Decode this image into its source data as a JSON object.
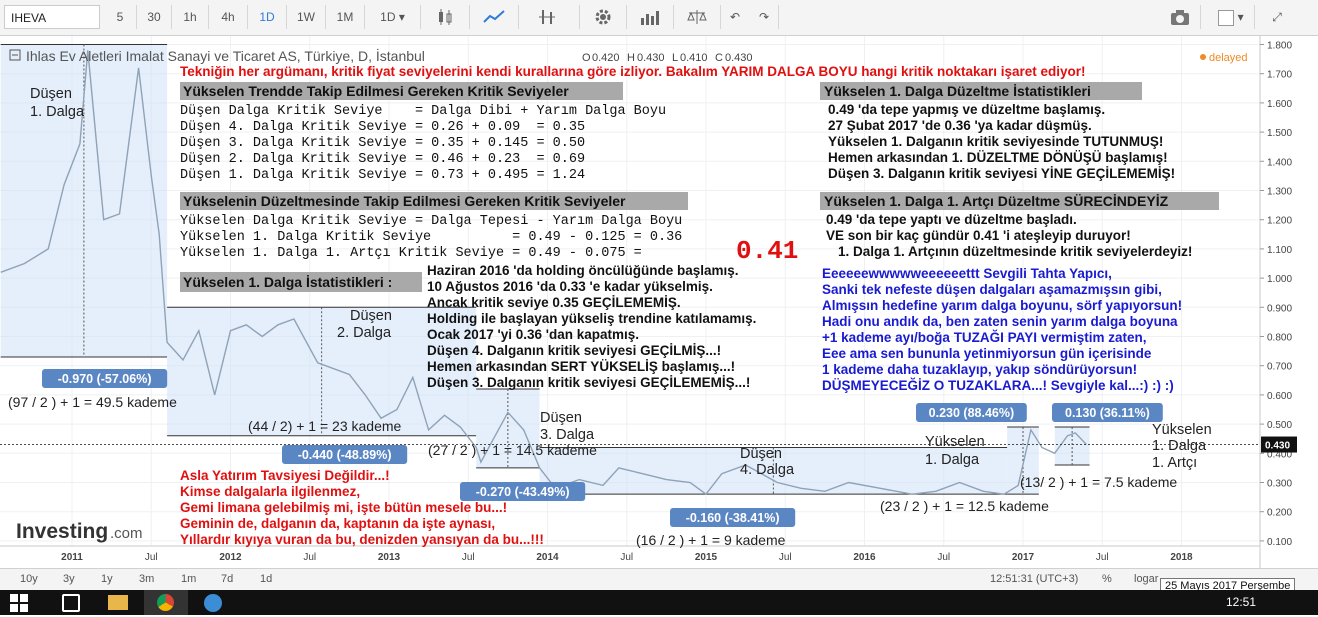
{
  "toolbar": {
    "symbol": "IHEVA",
    "intervals": [
      "5",
      "30",
      "1h",
      "4h",
      "1D",
      "1W",
      "1M"
    ],
    "active_interval": "1D",
    "interval_select": "1D"
  },
  "legend": {
    "title": "Ihlas Ev Aletleri Imalat Sanayi ve Ticaret AS, Türkiye, D, İstanbul",
    "o_label": "O",
    "o_value": "0.420",
    "h_label": "H",
    "h_value": "0.430",
    "l_label": "L",
    "l_value": "0.410",
    "c_label": "C",
    "c_value": "0.430",
    "status": "delayed"
  },
  "bottom": {
    "ranges": [
      "10y",
      "3y",
      "1y",
      "3m",
      "1m",
      "7d",
      "1d"
    ],
    "clock": "12:51:31 (UTC+3)",
    "percent": "%",
    "log": "logar",
    "auto": "auto",
    "tooltip_date": "25 Mayıs 2017 Perşembe"
  },
  "taskbar": {
    "time": "12:51"
  },
  "colors": {
    "price": "#8fa2b6",
    "box_fill": "#cfe2f7",
    "badge": "#5b86c4",
    "red": "#e01010",
    "blue": "#1a1ad0"
  },
  "chart_data": {
    "type": "line",
    "title": "Ihlas Ev Aletleri Imalat Sanayi ve Ticaret AS, Türkiye, D, İstanbul",
    "x_ticks": [
      "2011",
      "Jul",
      "2012",
      "Jul",
      "2013",
      "Jul",
      "2014",
      "Jul",
      "2015",
      "Jul",
      "2016",
      "Jul",
      "2017",
      "Jul",
      "2018"
    ],
    "y_ticks": [
      "1.800",
      "1.700",
      "1.600",
      "1.500",
      "1.400",
      "1.300",
      "1.200",
      "1.100",
      "1.000",
      "0.900",
      "0.800",
      "0.700",
      "0.600",
      "0.500",
      "0.400",
      "0.300",
      "0.200",
      "0.100"
    ],
    "ylim": [
      0.1,
      1.8
    ],
    "last_price": "0.430",
    "series": [
      {
        "values": [
          [
            2010.55,
            1.02
          ],
          [
            2010.7,
            1.05
          ],
          [
            2010.85,
            1.1
          ],
          [
            2010.95,
            1.32
          ],
          [
            2011.05,
            1.46
          ],
          [
            2011.1,
            1.78
          ],
          [
            2011.2,
            1.2
          ],
          [
            2011.3,
            1.22
          ],
          [
            2011.42,
            1.72
          ],
          [
            2011.5,
            1.35
          ],
          [
            2011.55,
            1.15
          ],
          [
            2011.6,
            0.78
          ],
          [
            2011.7,
            0.72
          ],
          [
            2011.8,
            0.82
          ],
          [
            2011.9,
            0.6
          ],
          [
            2012.0,
            0.82
          ],
          [
            2012.1,
            0.84
          ],
          [
            2012.2,
            0.8
          ],
          [
            2012.3,
            0.84
          ],
          [
            2012.4,
            0.86
          ],
          [
            2012.55,
            0.71
          ],
          [
            2012.75,
            0.67
          ],
          [
            2012.85,
            0.6
          ],
          [
            2012.95,
            0.52
          ],
          [
            2013.05,
            0.55
          ],
          [
            2013.15,
            0.66
          ],
          [
            2013.25,
            0.48
          ],
          [
            2013.35,
            0.53
          ],
          [
            2013.45,
            0.49
          ],
          [
            2013.55,
            0.42
          ],
          [
            2013.58,
            0.37
          ],
          [
            2013.65,
            0.44
          ],
          [
            2013.75,
            0.54
          ],
          [
            2013.85,
            0.48
          ],
          [
            2013.95,
            0.35
          ],
          [
            2014.05,
            0.28
          ],
          [
            2014.2,
            0.31
          ],
          [
            2014.35,
            0.29
          ],
          [
            2014.45,
            0.35
          ],
          [
            2014.6,
            0.33
          ],
          [
            2014.75,
            0.31
          ],
          [
            2014.9,
            0.3
          ],
          [
            2015.0,
            0.26
          ],
          [
            2015.1,
            0.33
          ],
          [
            2015.25,
            0.36
          ],
          [
            2015.45,
            0.3
          ],
          [
            2015.6,
            0.28
          ],
          [
            2015.75,
            0.27
          ],
          [
            2015.9,
            0.3
          ],
          [
            2016.1,
            0.28
          ],
          [
            2016.3,
            0.26
          ],
          [
            2016.45,
            0.27
          ],
          [
            2016.6,
            0.3
          ],
          [
            2016.75,
            0.27
          ],
          [
            2016.88,
            0.26
          ],
          [
            2016.97,
            0.29
          ],
          [
            2017.05,
            0.48
          ],
          [
            2017.12,
            0.42
          ],
          [
            2017.2,
            0.4
          ],
          [
            2017.28,
            0.46
          ],
          [
            2017.33,
            0.47
          ],
          [
            2017.4,
            0.43
          ]
        ]
      }
    ],
    "annotations": {
      "measure_badges": [
        "-0.970 (-57.06%)",
        "-0.440 (-48.89%)",
        "-0.270 (-43.49%)",
        "-0.160 (-38.41%)",
        "0.230 (88.46%)",
        "0.130 (36.11%)"
      ],
      "wave_labels": [
        "Düşen",
        "1. Dalga",
        "Düşen",
        "2. Dalga",
        "Düşen",
        "3. Dalga",
        "Düşen",
        "4. Dalga",
        "Yükselen",
        "1. Dalga",
        "Yükselen",
        "1. Dalga",
        "1. Artçı"
      ],
      "kademe": [
        "(97 / 2 ) + 1 = 49.5 kademe",
        "(44 / 2) + 1 = 23 kademe",
        "(27 / 2 ) + 1 = 14.5 kademe",
        "(16 / 2 ) + 1 = 9 kademe",
        "(23 / 2 ) + 1 = 12.5 kademe",
        "(13/ 2 ) + 1 = 7.5 kademe"
      ]
    }
  },
  "text": {
    "headline": "Tekniğin her argümanı, kritik fiyat seviyelerini kendi kurallarına göre izliyor. Bakalım YARIM DALGA BOYU hangi kritik noktakarı işaret ediyor!",
    "box1_header": "Yükselen Trendde Takip Edilmesi Gereken Kritik Seviyeler",
    "box1_lines": [
      "Düşen Dalga Kritik Seviye    = Dalga Dibi + Yarım Dalga Boyu",
      "Düşen 4. Dalga Kritik Seviye = 0.26 + 0.09  = 0.35",
      "Düşen 3. Dalga Kritik Seviye = 0.35 + 0.145 = 0.50",
      "Düşen 2. Dalga Kritik Seviye = 0.46 + 0.23  = 0.69",
      "Düşen 1. Dalga Kritik Seviye = 0.73 + 0.495 = 1.24"
    ],
    "box2_header": "Yükselenin Düzeltmesinde Takip Edilmesi Gereken Kritik Seviyeler",
    "box2_lines": [
      "Yükselen Dalga Kritik Seviye = Dalga Tepesi - Yarım Dalga Boyu",
      "Yükselen 1. Dalga Kritik Seviye          = 0.49 - 0.125 = 0.36",
      "Yükselen 1. Dalga 1. Artçı Kritik Seviye = 0.49 - 0.075 ="
    ],
    "big_value": "0.41",
    "stats_header": "Yükselen 1. Dalga İstatistikleri :",
    "stats_lines": [
      "Haziran 2016 'da holding öncülüğünde başlamış.",
      "10 Ağustos 2016 'da 0.33 'e kadar yükselmiş.",
      "Ancak kritik seviye 0.35 GEÇİLEMEMİŞ.",
      "Holding ile başlayan yükseliş trendine katılamamış.",
      "Ocak 2017 'yi 0.36 'dan kapatmış.",
      "Düşen 4. Dalganın kritik seviyesi GEÇİLMİŞ...!",
      "Hemen arkasından SERT YÜKSELİŞ başlamış...!",
      "Düşen 3. Dalganın kritik seviyesi GEÇİLEMEMİŞ...!"
    ],
    "right1_header": "Yükselen 1. Dalga Düzeltme İstatistikleri",
    "right1_lines": [
      "0.49 'da tepe yapmış ve düzeltme başlamış.",
      "27 Şubat 2017 'de 0.36 'ya kadar düşmüş.",
      "Yükselen 1. Dalganın kritik seviyesinde TUTUNMUŞ!",
      "Hemen arkasından 1. DÜZELTME DÖNÜŞÜ başlamış!",
      "Düşen 3. Dalganın kritik seviyesi YİNE GEÇİLEMEMİŞ!"
    ],
    "right2_header": "Yükselen 1. Dalga 1. Artçı Düzeltme SÜRECİNDEYİZ",
    "right2_lines": [
      "0.49 'da tepe yaptı ve düzeltme başladı.",
      "VE son bir kaç gündür 0.41 'i ateşleyip duruyor!",
      "1. Dalga 1. Artçının düzeltmesinde kritik seviyelerdeyiz!"
    ],
    "blue_lines": [
      "Eeeeeewwwwweeeeeettt Sevgili Tahta Yapıcı,",
      "Sanki tek nefeste düşen dalgaları aşamazmışsın gibi,",
      "Almışsın hedefine yarım dalga boyunu, sörf yapıyorsun!",
      "Hadi onu andık da, ben zaten senin yarım dalga boyuna",
      "+1 kademe ayı/boğa TUZAĞI PAYI vermiştim zaten,",
      "Eee ama sen bununla yetinmiyorsun gün içerisinde",
      "1 kademe daha tuzaklayıp, yakıp söndürüyorsun!",
      "DÜŞMEYECEĞİZ O TUZAKLARA...!  Sevgiyle kal...:) :) :)"
    ],
    "disclaimer": [
      "Asla Yatırım Tavsiyesi Değildir...!",
      "Kimse dalgalarla ilgilenmez,",
      "Gemi limana gelebilmiş mi, işte bütün mesele bu...!",
      "Geminin de, dalganın da, kaptanın da işte aynası,",
      "Yıllardır kıyıya vuran da bu, denizden yansıyan da bu...!!!"
    ],
    "logo": "Investing",
    "logo_suffix": ".com"
  }
}
